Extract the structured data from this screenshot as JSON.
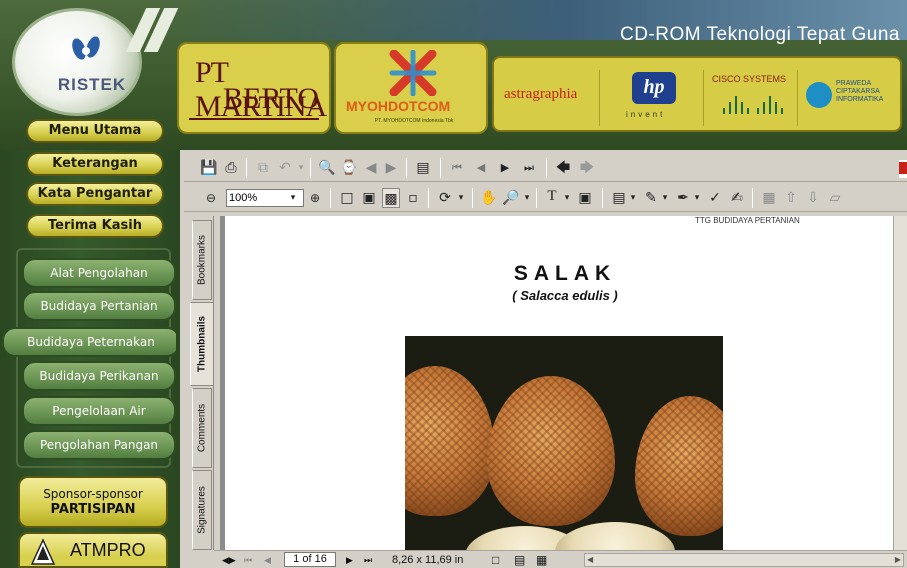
{
  "header": {
    "logo_text": "RISTEK",
    "title": "CD-ROM Teknologi Tepat Guna",
    "sponsors": {
      "martina_line1": "PT MARTINA",
      "martina_line2": "BERTO",
      "myoh_name": "MYOHDOTCOM",
      "myoh_sub": "PT. MYOHDOTCOM Indonesia Tbk",
      "astragraphia": "astragraphia",
      "hp_logo": "hp",
      "hp_invent": "invent",
      "cisco": "CISCO SYSTEMS",
      "praweda": "PRAWEDA CIPTAKARSA INFORMATIKA"
    }
  },
  "sidebar": {
    "main_buttons": [
      "Menu Utama",
      "Keterangan",
      "Kata Pengantar",
      "Terima Kasih"
    ],
    "category_buttons": [
      "Alat Pengolahan",
      "Budidaya Pertanian",
      "Budidaya Peternakan",
      "Budidaya Perikanan",
      "Pengelolaan Air",
      "Pengolahan Pangan"
    ],
    "sponsor_line1": "Sponsor-sponsor",
    "sponsor_line2": "PARTISIPAN",
    "atmpro": "ATMPRO"
  },
  "viewer": {
    "zoom": "100%",
    "nav_tabs": [
      "Bookmarks",
      "Thumbnails",
      "Comments",
      "Signatures"
    ],
    "active_tab": "Thumbnails",
    "page": {
      "running_head": "TTG BUDIDAYA PERTANIAN",
      "title": "SALAK",
      "subtitle": "( Salacca edulis )"
    },
    "status": {
      "page_indicator": "1 of 16",
      "page_size": "8,26 x 11,69 in"
    }
  },
  "colors": {
    "header_green": "#3c5a2d",
    "sidebar_green": "#355a2b",
    "yellow_button": "#d9d254",
    "green_button": "#6d9656",
    "viewer_gray": "#d4d0c8"
  }
}
